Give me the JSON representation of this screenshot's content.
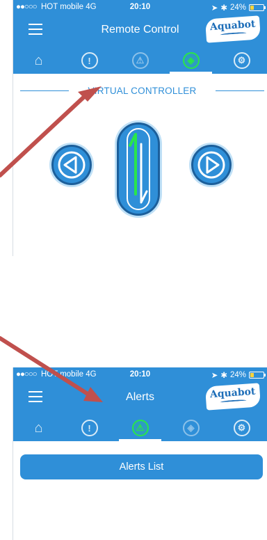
{
  "screen1": {
    "status": {
      "carrier": "HOT mobile",
      "network": "4G",
      "time": "20:10",
      "battery": "24%"
    },
    "title": "Remote Control",
    "logo": "Aquabot",
    "tabs": [
      {
        "icon": "home-icon"
      },
      {
        "icon": "exclamation-icon"
      },
      {
        "icon": "warning-icon"
      },
      {
        "icon": "remote-icon",
        "active": true
      },
      {
        "icon": "gears-icon"
      }
    ],
    "section_label": "VIRTUAL CONTROLLER"
  },
  "screen2": {
    "status": {
      "carrier": "HOT mobile",
      "network": "4G",
      "time": "20:10",
      "battery": "24%"
    },
    "title": "Alerts",
    "logo": "Aquabot",
    "tabs": [
      {
        "icon": "home-icon"
      },
      {
        "icon": "exclamation-icon"
      },
      {
        "icon": "warning-icon",
        "active": true
      },
      {
        "icon": "remote-icon"
      },
      {
        "icon": "gears-icon"
      }
    ],
    "alerts_list_label": "Alerts List"
  },
  "colors": {
    "header": "#2f8fd8",
    "accent_green": "#29e64a",
    "annotation_arrow": "#c0504d"
  }
}
